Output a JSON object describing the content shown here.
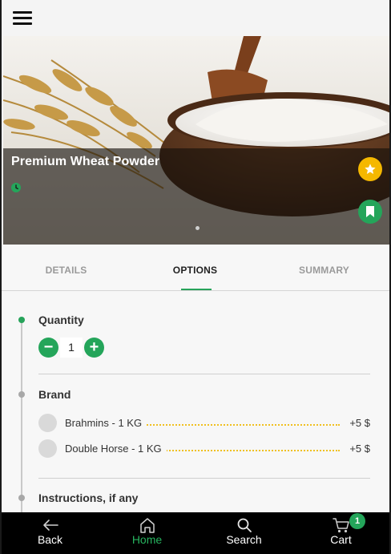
{
  "product": {
    "title": "Premium Wheat Powder",
    "image_description_icon": "wheat-flour-bowl-image"
  },
  "tabs": [
    {
      "label": "DETAILS",
      "active": false
    },
    {
      "label": "OPTIONS",
      "active": true
    },
    {
      "label": "SUMMARY",
      "active": false
    }
  ],
  "options": {
    "quantity": {
      "title": "Quantity",
      "value": "1",
      "minus": "−",
      "plus": "+"
    },
    "brand": {
      "title": "Brand",
      "choices": [
        {
          "label": "Brahmins - 1 KG",
          "price": "+5 $"
        },
        {
          "label": "Double Horse - 1 KG",
          "price": "+5 $"
        }
      ]
    },
    "instructions": {
      "title": "Instructions, if any"
    }
  },
  "nav": {
    "items": [
      {
        "label": "Back",
        "icon": "arrow-left-icon",
        "active": false
      },
      {
        "label": "Home",
        "icon": "home-icon",
        "active": true
      },
      {
        "label": "Search",
        "icon": "search-icon",
        "active": false
      },
      {
        "label": "Cart",
        "icon": "cart-icon",
        "active": false
      }
    ],
    "cart_count": "1"
  },
  "colors": {
    "accent": "#24a55a",
    "favorite": "#f5b800",
    "leader": "#f0c020",
    "nav_bg": "#000000"
  }
}
